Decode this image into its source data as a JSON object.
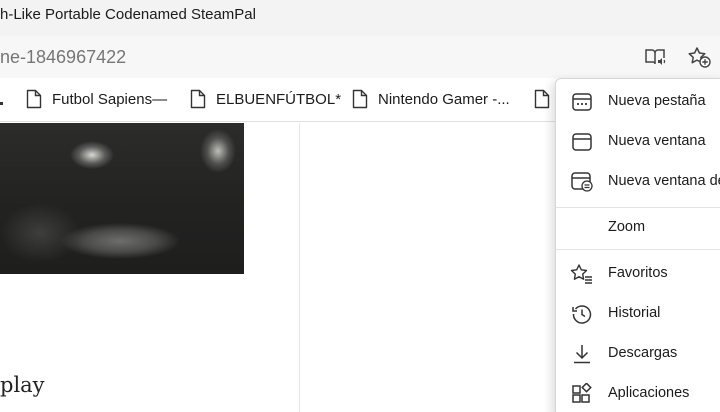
{
  "window": {
    "title": "h-Like Portable Codenamed SteamPal"
  },
  "address_bar": {
    "url": "ne-1846967422",
    "icons": [
      "immersive-reader-icon",
      "add-favorite-icon"
    ]
  },
  "favorites_bar": {
    "items": [
      {
        "label": "",
        "icon": "page-icon"
      },
      {
        "label": "Futbol Sapiens—",
        "icon": "page-icon"
      },
      {
        "label": "ELBUENFÚTBOL*",
        "icon": "page-icon"
      },
      {
        "label": "Nintendo Gamer -...",
        "icon": "page-icon"
      },
      {
        "label": "",
        "icon": "page-icon"
      }
    ]
  },
  "page": {
    "article_text": "play"
  },
  "settings_menu": {
    "items": [
      {
        "label": "Nueva pestaña",
        "icon": "new-tab-icon"
      },
      {
        "label": "Nueva ventana",
        "icon": "new-window-icon"
      },
      {
        "label": "Nueva ventana de",
        "icon": "inprivate-window-icon"
      },
      {
        "label": "Zoom",
        "icon": ""
      },
      {
        "label": "Favoritos",
        "icon": "star-list-icon"
      },
      {
        "label": "Historial",
        "icon": "history-icon"
      },
      {
        "label": "Descargas",
        "icon": "download-icon"
      },
      {
        "label": "Aplicaciones",
        "icon": "apps-icon"
      }
    ]
  }
}
